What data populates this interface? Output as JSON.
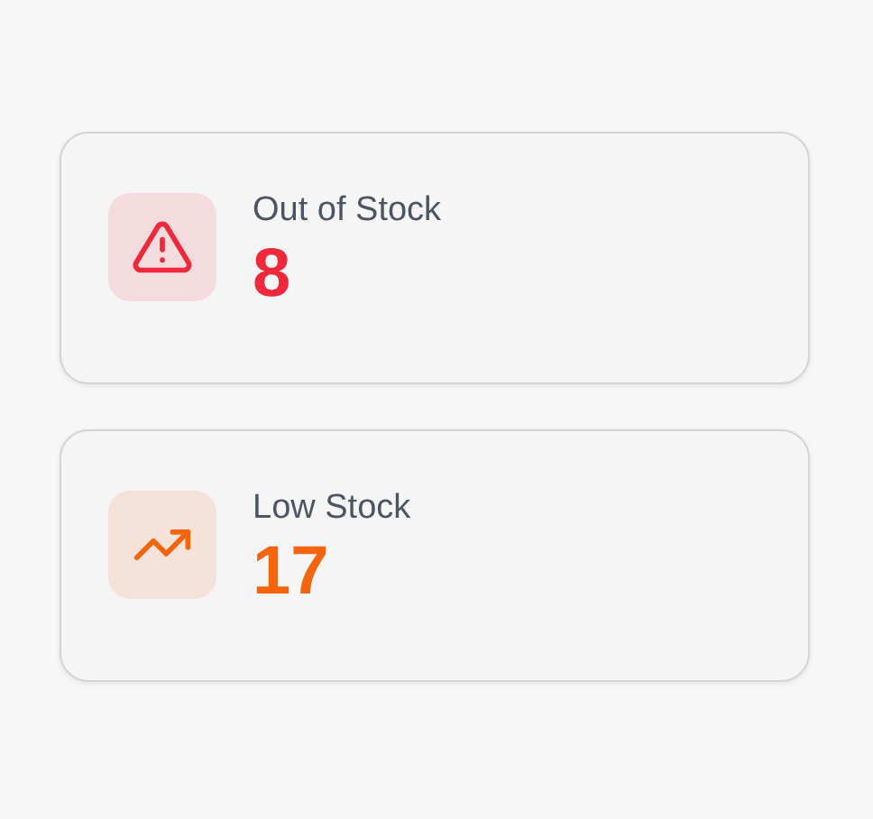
{
  "cards": [
    {
      "kind": "alert",
      "label": "Out of Stock",
      "value": "8",
      "color": "#f0283c"
    },
    {
      "kind": "trend",
      "label": "Low Stock",
      "value": "17",
      "color": "#f4650e"
    }
  ]
}
